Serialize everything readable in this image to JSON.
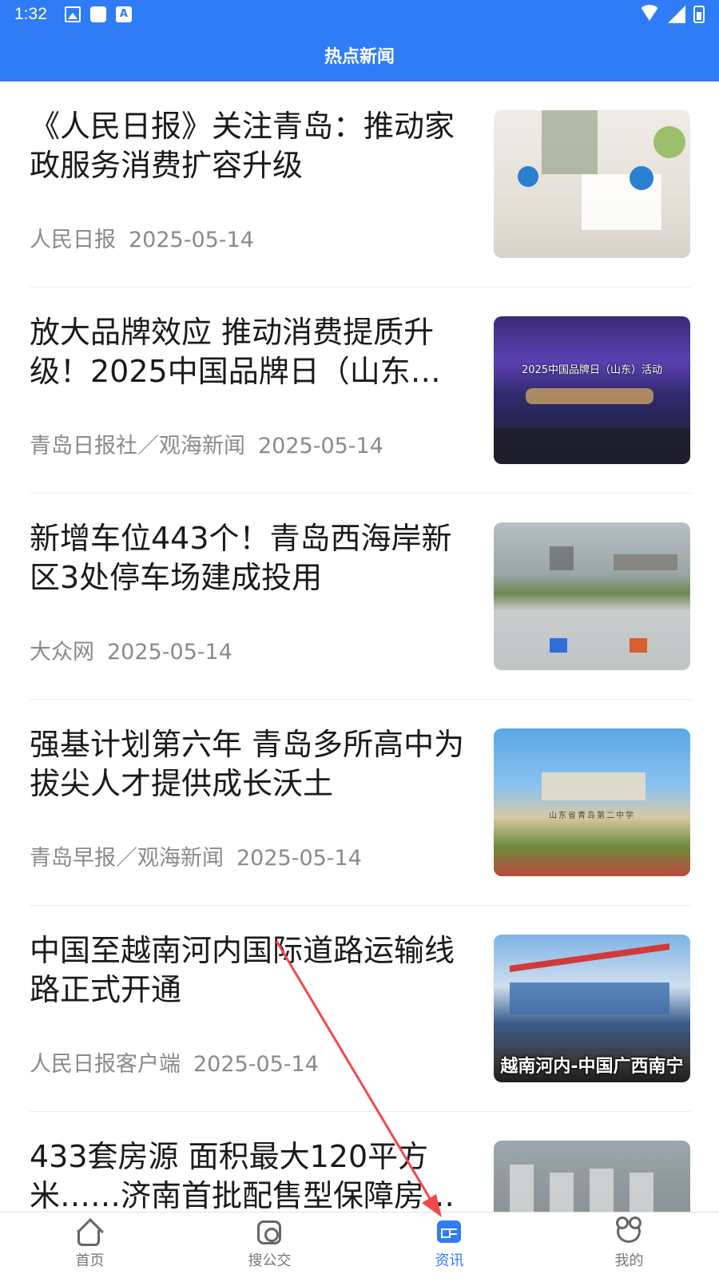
{
  "status_bar": {
    "time": "1:32",
    "a_icon": "A"
  },
  "header": {
    "title": "热点新闻"
  },
  "news": [
    {
      "title": "《人民日报》关注青岛：推动家政服务消费扩容升级",
      "source": "人民日报",
      "date": "2025-05-14"
    },
    {
      "title": "放大品牌效应 推动消费提质升级！2025中国品牌日（山东…",
      "source": "青岛日报社／观海新闻",
      "date": "2025-05-14",
      "thumb_banner": "2025中国品牌日（山东）活动"
    },
    {
      "title": "新增车位443个！青岛西海岸新区3处停车场建成投用",
      "source": "大众网",
      "date": "2025-05-14"
    },
    {
      "title": "强基计划第六年 青岛多所高中为拔尖人才提供成长沃土",
      "source": "青岛早报／观海新闻",
      "date": "2025-05-14",
      "thumb_sign": "山东省青岛第二中学"
    },
    {
      "title": "中国至越南河内国际道路运输线路正式开通",
      "source": "人民日报客户端",
      "date": "2025-05-14",
      "thumb_caption": "越南河内-中国广西南宁"
    },
    {
      "title": "433套房源 面积最大120平方米……济南首批配售型保障房…",
      "source": "",
      "date": ""
    }
  ],
  "tabs": [
    {
      "label": "首页",
      "icon": "home-icon",
      "active": false
    },
    {
      "label": "搜公交",
      "icon": "bus-search-icon",
      "active": false
    },
    {
      "label": "资讯",
      "icon": "news-icon",
      "active": true
    },
    {
      "label": "我的",
      "icon": "profile-icon",
      "active": false
    }
  ],
  "colors": {
    "primary": "#2f7cf6",
    "annotation_arrow": "#f04a4a"
  }
}
